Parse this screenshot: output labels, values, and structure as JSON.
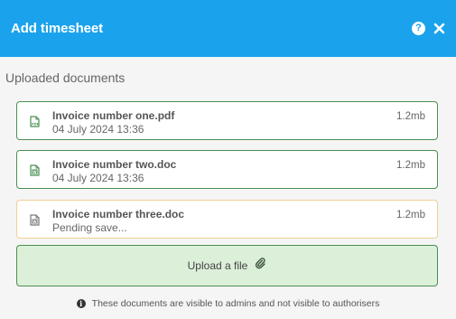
{
  "dialog": {
    "title": "Add timesheet",
    "help_glyph": "?",
    "icons": [
      "help-icon",
      "close-icon"
    ],
    "accent_color": "#1aa3ec"
  },
  "section": {
    "title": "Uploaded documents"
  },
  "documents": [
    {
      "name": "Invoice number one.pdf",
      "meta": "04 July 2024 13:36",
      "size": "1.2mb",
      "icon": "pdf-file-icon",
      "state": "saved",
      "border_color": "#4b8f52"
    },
    {
      "name": "Invoice number two.doc",
      "meta": "04 July 2024 13:36",
      "size": "1.2mb",
      "icon": "word-file-icon",
      "state": "saved",
      "border_color": "#4b8f52"
    },
    {
      "name": "Invoice number three.doc",
      "meta": "Pending save...",
      "size": "1.2mb",
      "icon": "word-file-icon",
      "state": "pending",
      "border_color": "#f0cf95"
    }
  ],
  "upload": {
    "label": "Upload a file",
    "icon": "paperclip-icon",
    "background": "#dcefd9"
  },
  "note": {
    "icon_glyph": "i",
    "text": "These documents are visible to admins and not visible to authorisers"
  }
}
